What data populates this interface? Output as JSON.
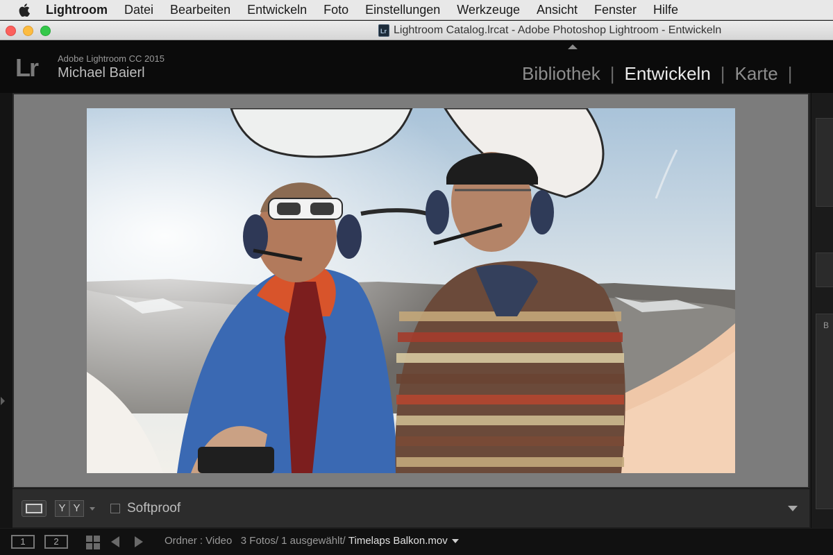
{
  "menubar": {
    "app": "Lightroom",
    "items": [
      "Datei",
      "Bearbeiten",
      "Entwickeln",
      "Foto",
      "Einstellungen",
      "Werkzeuge",
      "Ansicht",
      "Fenster",
      "Hilfe"
    ]
  },
  "window": {
    "title": "Lightroom Catalog.lrcat - Adobe Photoshop Lightroom - Entwickeln"
  },
  "identity": {
    "logo": "Lr",
    "product": "Adobe Lightroom CC 2015",
    "user": "Michael Baierl"
  },
  "modules": {
    "items": [
      "Bibliothek",
      "Entwickeln",
      "Karte"
    ],
    "active": "Entwickeln",
    "separator": "|"
  },
  "toolbar": {
    "view_before_after": "Y|Y",
    "yy_left": "Y",
    "yy_right": "Y",
    "softproof_label": "Softproof",
    "softproof_checked": false
  },
  "right_panel": {
    "header_fragment": "B"
  },
  "filmstrip": {
    "monitor1": "1",
    "monitor2": "2",
    "source_label": "Ordner : Video",
    "count_text": "3 Fotos/ 1 ausgewählt/",
    "filename": "Timelaps Balkon.mov"
  },
  "colors": {
    "lr_background": "#0b0b0b",
    "active_module": "#eaeaea",
    "inactive_module": "#8d8d8d",
    "preview_background": "#7c7c7c"
  }
}
